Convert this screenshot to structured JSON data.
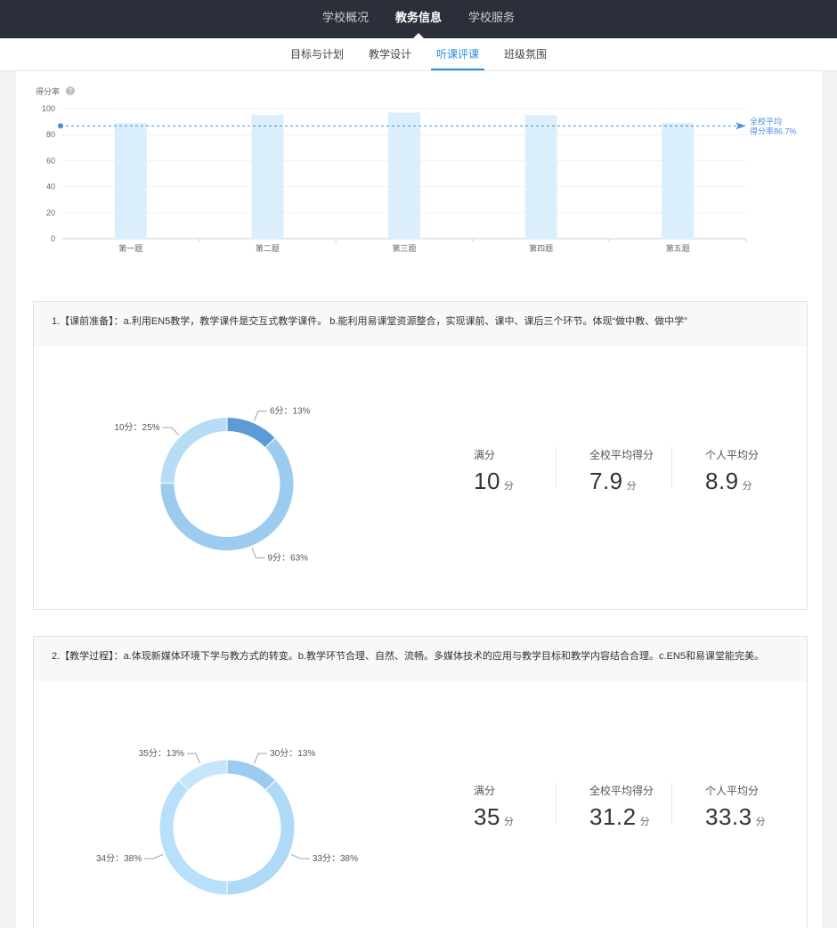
{
  "topnav": {
    "items": [
      {
        "label": "学校概况"
      },
      {
        "label": "教务信息",
        "active": true
      },
      {
        "label": "学校服务"
      }
    ]
  },
  "subnav": {
    "items": [
      {
        "label": "目标与计划"
      },
      {
        "label": "教学设计"
      },
      {
        "label": "听课评课",
        "active": true
      },
      {
        "label": "班级氛围"
      }
    ]
  },
  "chart_data": [
    {
      "type": "bar",
      "ylabel": "得分率",
      "ylim": [
        0,
        100
      ],
      "yticks": [
        0,
        20,
        40,
        60,
        80,
        100
      ],
      "categories": [
        "第一题",
        "第二题",
        "第三题",
        "第四题",
        "第五题"
      ],
      "values": [
        89,
        95,
        97,
        95,
        89
      ],
      "reference": {
        "label_line1": "全校平均",
        "label_line2": "得分率86.7%",
        "value": 86.7
      },
      "colors": {
        "bar": "#daeefc",
        "reference": "#4a90d9"
      }
    },
    {
      "type": "pie",
      "slices": [
        {
          "label": "6分：13%",
          "value": 13,
          "color": "#5b9bd6"
        },
        {
          "label": "9分：63%",
          "value": 63,
          "color": "#9ccbf0"
        },
        {
          "label": "10分：25%",
          "value": 25,
          "color": "#b6dcf6"
        }
      ]
    },
    {
      "type": "pie",
      "slices": [
        {
          "label": "30分：13%",
          "value": 13,
          "color": "#9ccbf0"
        },
        {
          "label": "33分：38%",
          "value": 38,
          "color": "#aedaf8"
        },
        {
          "label": "34分：38%",
          "value": 38,
          "color": "#b8e0fa"
        },
        {
          "label": "35分：13%",
          "value": 13,
          "color": "#c3e6fb"
        }
      ]
    }
  ],
  "questions": [
    {
      "title": "1.【课前准备】：a.利用EN5教学，教学课件是交互式教学课件。 b.能利用易课堂资源整合，实现课前、课中、课后三个环节。体现“做中教、做中学”",
      "stats": [
        {
          "label": "满分",
          "value": "10",
          "unit": "分"
        },
        {
          "label": "全校平均得分",
          "value": "7.9",
          "unit": "分"
        },
        {
          "label": "个人平均分",
          "value": "8.9",
          "unit": "分"
        }
      ]
    },
    {
      "title": "2.【教学过程】：a.体现新媒体环境下学与教方式的转变。b.教学环节合理、自然、流畅。多媒体技术的应用与教学目标和教学内容结合合理。c.EN5和易课堂能完美。",
      "stats": [
        {
          "label": "满分",
          "value": "35",
          "unit": "分"
        },
        {
          "label": "全校平均得分",
          "value": "31.2",
          "unit": "分"
        },
        {
          "label": "个人平均分",
          "value": "33.3",
          "unit": "分"
        }
      ]
    }
  ]
}
